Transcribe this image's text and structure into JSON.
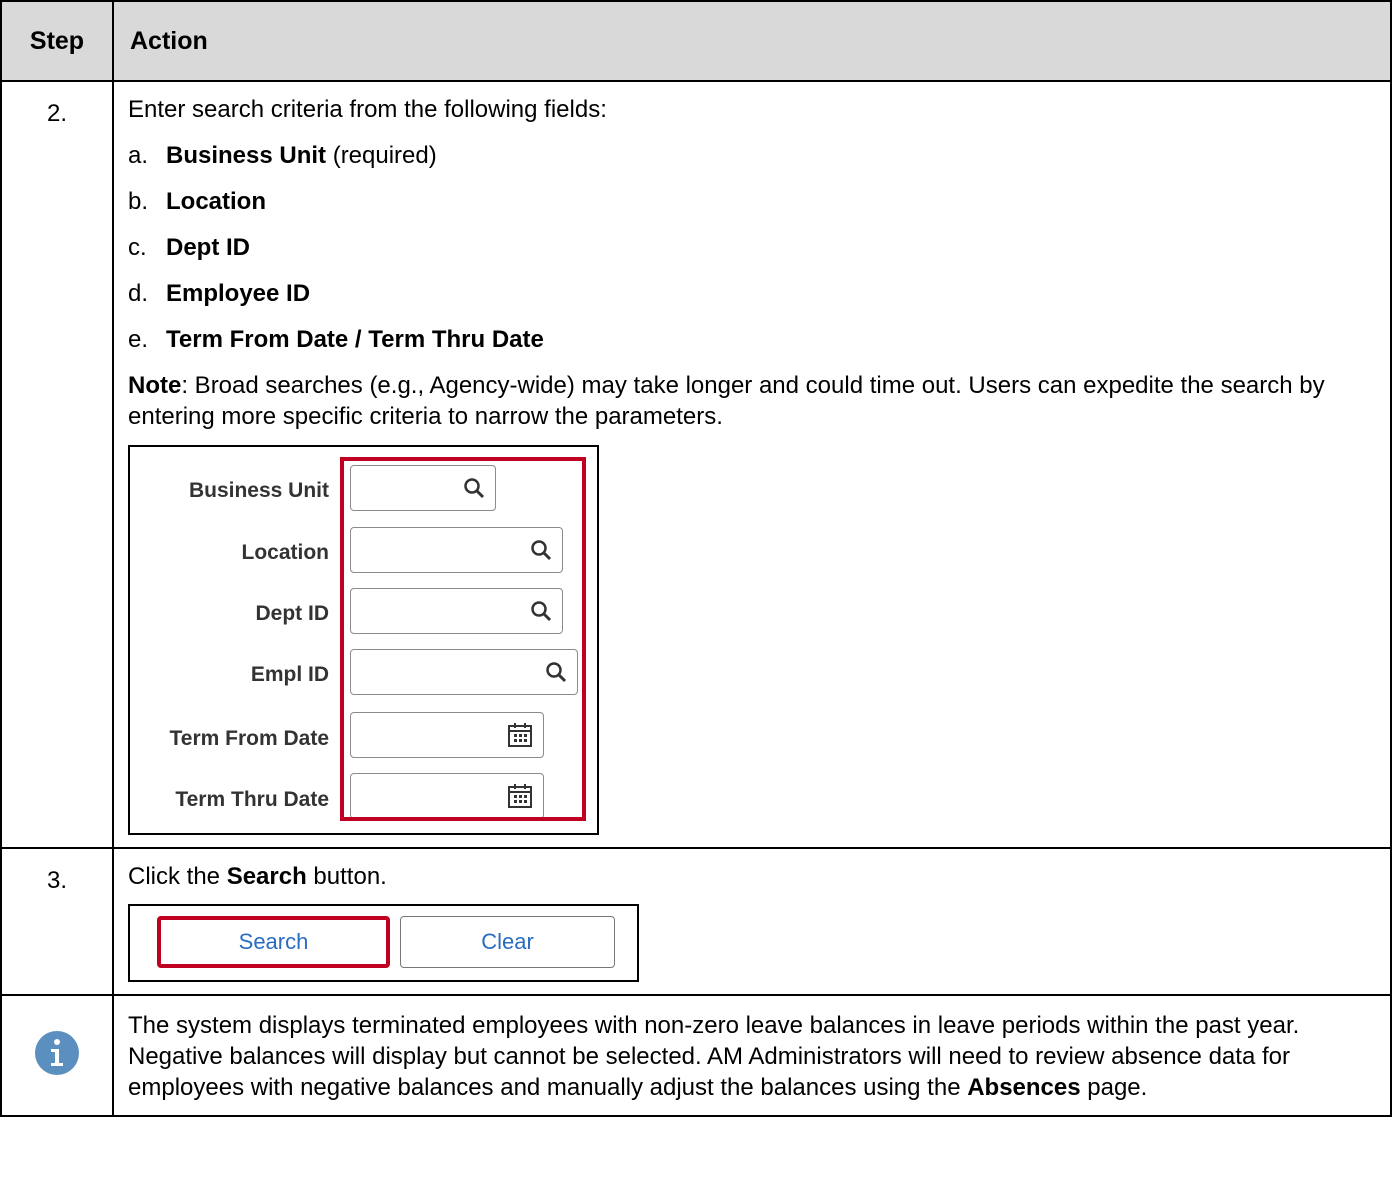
{
  "header": {
    "step": "Step",
    "action": "Action"
  },
  "step2": {
    "number": "2.",
    "intro": "Enter search criteria from the following fields:",
    "items": [
      {
        "letter": "a.",
        "bold": "Business Unit",
        "rest": " (required)"
      },
      {
        "letter": "b.",
        "bold": "Location",
        "rest": ""
      },
      {
        "letter": "c.",
        "bold": "Dept ID",
        "rest": ""
      },
      {
        "letter": "d.",
        "bold": "Employee ID",
        "rest": ""
      },
      {
        "letter": "e.",
        "bold": "Term From Date / Term Thru Date",
        "rest": ""
      }
    ],
    "note_label": "Note",
    "note_text": ": Broad searches (e.g., Agency-wide) may take longer and could time out. Users can expedite the search by entering more specific criteria to narrow the parameters.",
    "form": {
      "business_unit": "Business Unit",
      "location": "Location",
      "dept_id": "Dept ID",
      "empl_id": "Empl ID",
      "term_from": "Term From Date",
      "term_thru": "Term Thru Date"
    }
  },
  "step3": {
    "number": "3.",
    "pre": "Click the ",
    "bold": "Search",
    "post": " button.",
    "search_button": "Search",
    "clear_button": "Clear"
  },
  "info": {
    "icon": "info-icon",
    "text_before": "The system displays terminated employees with non-zero leave balances in leave periods within the past year. Negative balances will display but cannot be selected. AM Administrators will need to review absence data for employees with negative balances and manually adjust the balances using the ",
    "bold": "Absences",
    "text_after": " page."
  },
  "colors": {
    "highlight": "#c00020",
    "link": "#2a6cc0",
    "info_icon": "#5b8fbf",
    "header_bg": "#d9d9d9"
  }
}
